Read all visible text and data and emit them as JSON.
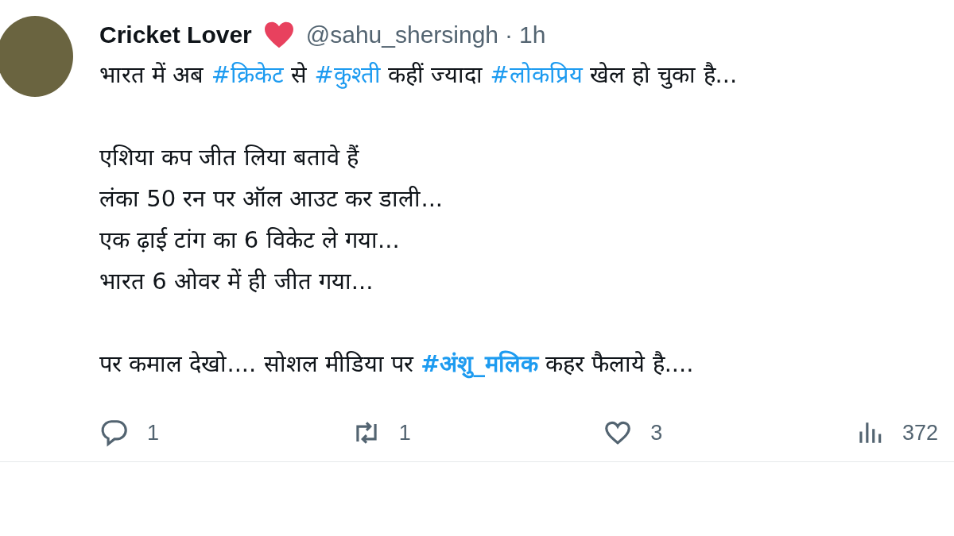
{
  "tweet": {
    "author": {
      "name": "Cricket Lover",
      "handle": "@sahu_shersingh",
      "separator": "·",
      "time": "1h"
    },
    "paragraphs": [
      [
        [
          {
            "kind": "plain",
            "text": "भारत में अब "
          },
          {
            "kind": "hashtag",
            "text": "#क्रिकेट"
          },
          {
            "kind": "plain",
            "text": " से "
          },
          {
            "kind": "hashtag",
            "text": "#कुश्ती"
          },
          {
            "kind": "plain",
            "text": " कहीं ज्यादा "
          },
          {
            "kind": "hashtag",
            "text": "#लोकप्रिय"
          },
          {
            "kind": "plain",
            "text": " खेल हो चुका है..."
          }
        ]
      ],
      [
        [
          {
            "kind": "plain",
            "text": "एशिया कप जीत लिया बतावे हैं"
          }
        ],
        [
          {
            "kind": "plain",
            "text": "लंका 50 रन पर ऑल आउट कर डाली..."
          }
        ],
        [
          {
            "kind": "plain",
            "text": "एक ढ़ाई टांग का 6 विकेट ले गया..."
          }
        ],
        [
          {
            "kind": "plain",
            "text": "भारत 6 ओवर में ही जीत गया..."
          }
        ]
      ],
      [
        [
          {
            "kind": "plain",
            "text": "पर कमाल देखो.... सोशल मीडिया पर "
          },
          {
            "kind": "hashtag",
            "text": "#अंशु_मलिक",
            "bold": true
          },
          {
            "kind": "plain",
            "text": " कहर फैलाये है...."
          }
        ]
      ]
    ],
    "actions": [
      {
        "kind": "reply",
        "count": "1"
      },
      {
        "kind": "retweet",
        "count": "1"
      },
      {
        "kind": "like",
        "count": "3"
      },
      {
        "kind": "views",
        "count": "372"
      }
    ]
  }
}
